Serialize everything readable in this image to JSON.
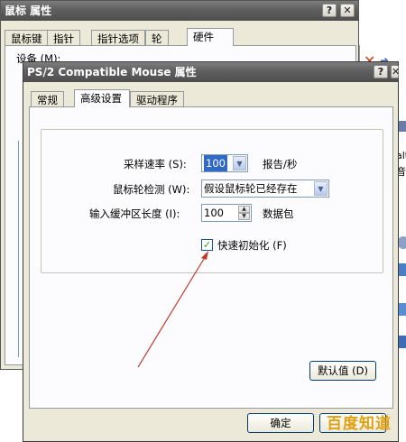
{
  "outer_window": {
    "title": "鼠标 属性",
    "help_btn": "?",
    "close_btn": "✕",
    "tabs": [
      "鼠标键",
      "指针",
      "指针选项",
      "轮",
      "硬件"
    ],
    "device_label": "设备 (M):"
  },
  "dialog": {
    "title": "PS/2 Compatible Mouse 属性",
    "help_btn": "?",
    "close_btn": "✕",
    "tabs": [
      "常规",
      "高级设置",
      "驱动程序"
    ],
    "active_tab": "高级设置",
    "sample_rate": {
      "label": "采样速率 (S):",
      "value": "100",
      "unit": "报告/秒"
    },
    "wheel_detect": {
      "label": "鼠标轮检测 (W):",
      "value": "假设鼠标轮已经存在"
    },
    "buffer_length": {
      "label": "输入缓冲区长度 (I):",
      "value": "100",
      "unit": "数据包"
    },
    "fast_init": {
      "label": "快速初始化 (F)",
      "checked": true,
      "check_glyph": "✓"
    },
    "defaults_button": "默认值 (D)",
    "ok_button": "确定"
  },
  "background_fragments": {
    "text_1": "alt",
    "text_2": "音",
    "watermark": "百度知道"
  },
  "annotation_arrow_color": "#c0392b"
}
